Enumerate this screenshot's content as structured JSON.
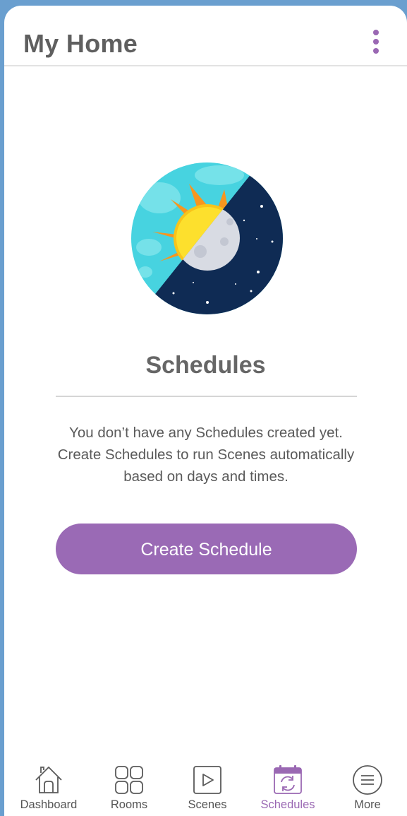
{
  "header": {
    "title": "My Home",
    "menu_icon": "kebab-menu-icon"
  },
  "main": {
    "illustration": "day-night-icon",
    "title": "Schedules",
    "description": "You don’t have any Schedules created yet.\nCreate Schedules to run Scenes automatically\nbased on days and times.",
    "create_button_label": "Create Schedule"
  },
  "tabbar": {
    "items": [
      {
        "label": "Dashboard",
        "icon": "house-icon",
        "active": false
      },
      {
        "label": "Rooms",
        "icon": "grid-icon",
        "active": false
      },
      {
        "label": "Scenes",
        "icon": "play-icon",
        "active": false
      },
      {
        "label": "Schedules",
        "icon": "calendar-refresh-icon",
        "active": true
      },
      {
        "label": "More",
        "icon": "menu-circle-icon",
        "active": false
      }
    ]
  },
  "colors": {
    "accent": "#9a68b3",
    "title_text": "#5f5f5f",
    "background": "#6a9fcf"
  }
}
